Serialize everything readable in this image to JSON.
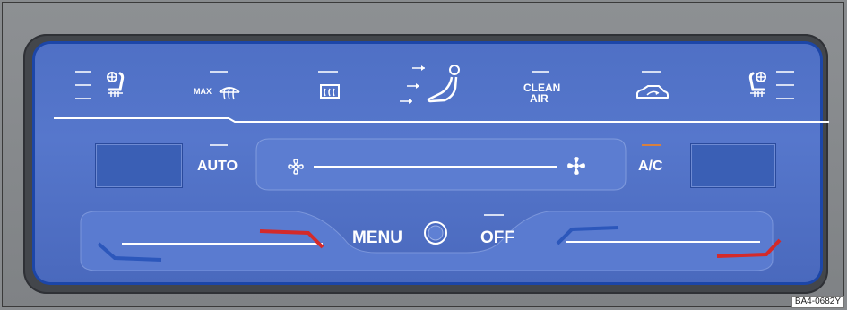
{
  "top_row": {
    "max_label": "MAX",
    "clean_air_line1": "CLEAN",
    "clean_air_line2": "AIR"
  },
  "buttons": {
    "auto_label": "AUTO",
    "ac_label": "A/C",
    "menu_label": "MENU",
    "off_label": "OFF"
  },
  "figure_id": "BA4-0682Y",
  "colors": {
    "panel": "#5677cc",
    "indicator_white": "#d6def3",
    "indicator_orange": "#d7803f",
    "temperature_red": "#d42a2a",
    "temperature_blue": "#2c57bb"
  },
  "icons": [
    "seat-heat-left-icon",
    "max-defrost-icon",
    "rear-defrost-icon",
    "air-distribution-icon",
    "recirculation-icon",
    "seat-heat-right-icon",
    "fan-low-icon",
    "fan-high-icon",
    "menu-knob-icon"
  ]
}
